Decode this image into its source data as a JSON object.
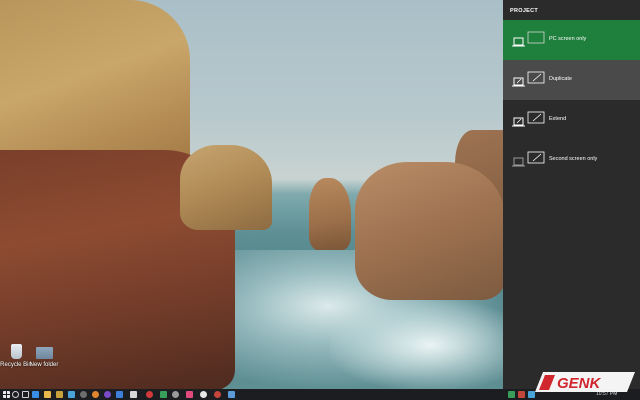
{
  "desktop": {
    "icons": [
      {
        "label": "Recycle Bin"
      },
      {
        "label": "New folder"
      }
    ]
  },
  "project_panel": {
    "title": "PROJECT",
    "options": [
      {
        "label": "PC screen only",
        "state": "selected"
      },
      {
        "label": "Duplicate",
        "state": "hover"
      },
      {
        "label": "Extend",
        "state": "normal"
      },
      {
        "label": "Second screen only",
        "state": "normal"
      }
    ],
    "selected_color": "#1f7f3c",
    "hover_color": "#4a4a4a",
    "background_color": "#2b2b2b"
  },
  "taskbar": {
    "icons": [
      "start-icon",
      "search-icon",
      "task-view-icon",
      "explorer-icon",
      "edge-icon",
      "store-icon",
      "mail-icon",
      "app-icon",
      "app-icon",
      "app-icon",
      "app-icon",
      "app-icon",
      "app-icon",
      "app-icon",
      "app-icon",
      "app-icon",
      "app-icon",
      "app-icon",
      "app-icon",
      "app-icon",
      "app-icon",
      "app-icon",
      "app-icon",
      "app-icon",
      "app-icon",
      "app-icon",
      "app-icon"
    ],
    "clock": "10:57 PM"
  },
  "watermark": {
    "brand": "GENK"
  }
}
